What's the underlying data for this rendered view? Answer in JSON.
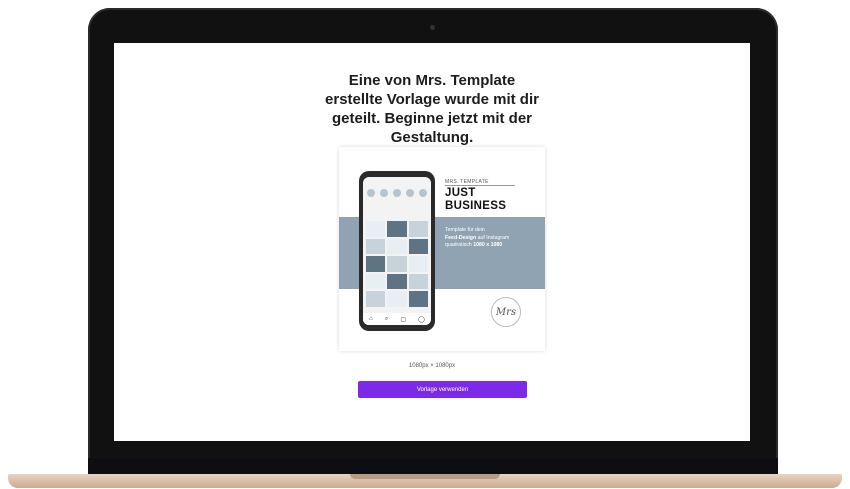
{
  "heading": {
    "line1": "Eine von Mrs. Template",
    "line2": "erstellte Vorlage wurde mit dir",
    "line3": "geteilt. Beginne jetzt mit der",
    "line4": "Gestaltung."
  },
  "template_preview": {
    "brand": "MRS. TEMPLATE",
    "title_line1": "JUST",
    "title_line2": "BUSINESS",
    "desc_part1": "Template für dein",
    "desc_bold1": "Feed-Design",
    "desc_part2": "auf Instagram",
    "desc_part3": "quadratisch",
    "desc_bold2": "1080 x 1080",
    "logo_text": "Mrs"
  },
  "dimensions": "1080px × 1080px",
  "use_button_label": "Vorlage verwenden",
  "colors": {
    "accent": "#7d2ae8",
    "band": "#8fa3b2"
  }
}
